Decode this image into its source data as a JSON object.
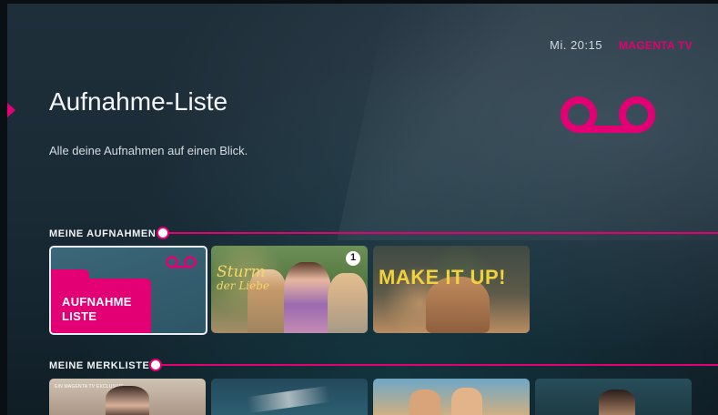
{
  "header": {
    "clock": "Mi. 20:15",
    "brand": "MAGENTA TV"
  },
  "page": {
    "title": "Aufnahme-Liste",
    "subtitle": "Alle deine Aufnahmen auf einen Blick.",
    "hero_icon": "voicemail-icon"
  },
  "sections": {
    "recordings": {
      "label": "MEINE AUFNAHMEN",
      "cards": [
        {
          "label_line1": "AUFNAHME",
          "label_line2": "LISTE",
          "icon": "voicemail-icon"
        },
        {
          "title": "Sturm der Liebe",
          "title_line1": "Sturm",
          "title_line2": "der Liebe",
          "badge": "ard-one-icon"
        },
        {
          "title": "MAKE IT UP!"
        }
      ]
    },
    "watchlist": {
      "label": "MEINE MERKLISTE",
      "cards": [
        {
          "badge_text": "EIN MAGENTA TV EXCLUSIVE"
        },
        {},
        {},
        {}
      ]
    }
  },
  "colors": {
    "accent": "#e20074",
    "background": "#1b2b36"
  }
}
